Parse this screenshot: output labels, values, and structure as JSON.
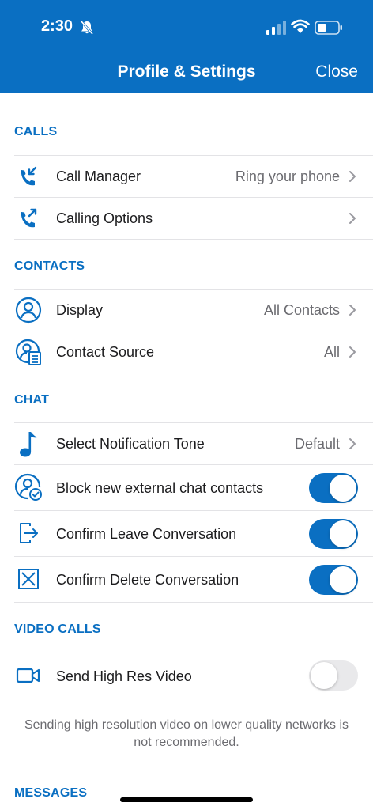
{
  "status_bar": {
    "time": "2:30"
  },
  "nav": {
    "title": "Profile & Settings",
    "close": "Close"
  },
  "sections": {
    "calls": "CALLS",
    "contacts": "CONTACTS",
    "chat": "CHAT",
    "video_calls": "VIDEO CALLS",
    "messages": "MESSAGES"
  },
  "rows": {
    "call_manager": {
      "label": "Call Manager",
      "value": "Ring your phone",
      "icon": "incoming-call-icon"
    },
    "calling_options": {
      "label": "Calling Options",
      "icon": "outgoing-call-icon"
    },
    "display": {
      "label": "Display",
      "value": "All Contacts",
      "icon": "person-circle-icon"
    },
    "contact_source": {
      "label": "Contact Source",
      "value": "All",
      "icon": "contact-list-icon"
    },
    "notification_tone": {
      "label": "Select Notification Tone",
      "value": "Default",
      "icon": "music-note-icon"
    },
    "block_external": {
      "label": "Block new external chat contacts",
      "enabled": true,
      "icon": "person-check-icon"
    },
    "confirm_leave": {
      "label": "Confirm Leave Conversation",
      "enabled": true,
      "icon": "leave-icon"
    },
    "confirm_delete": {
      "label": "Confirm Delete Conversation",
      "enabled": true,
      "icon": "delete-box-icon"
    },
    "high_res_video": {
      "label": "Send High Res Video",
      "enabled": false,
      "icon": "video-camera-icon"
    }
  },
  "video_footnote": "Sending high resolution video on lower quality networks is not recommended.",
  "colors": {
    "accent": "#0a6fc2",
    "toggle_off": "#e9e9eb",
    "divider": "#e3e3e6"
  }
}
